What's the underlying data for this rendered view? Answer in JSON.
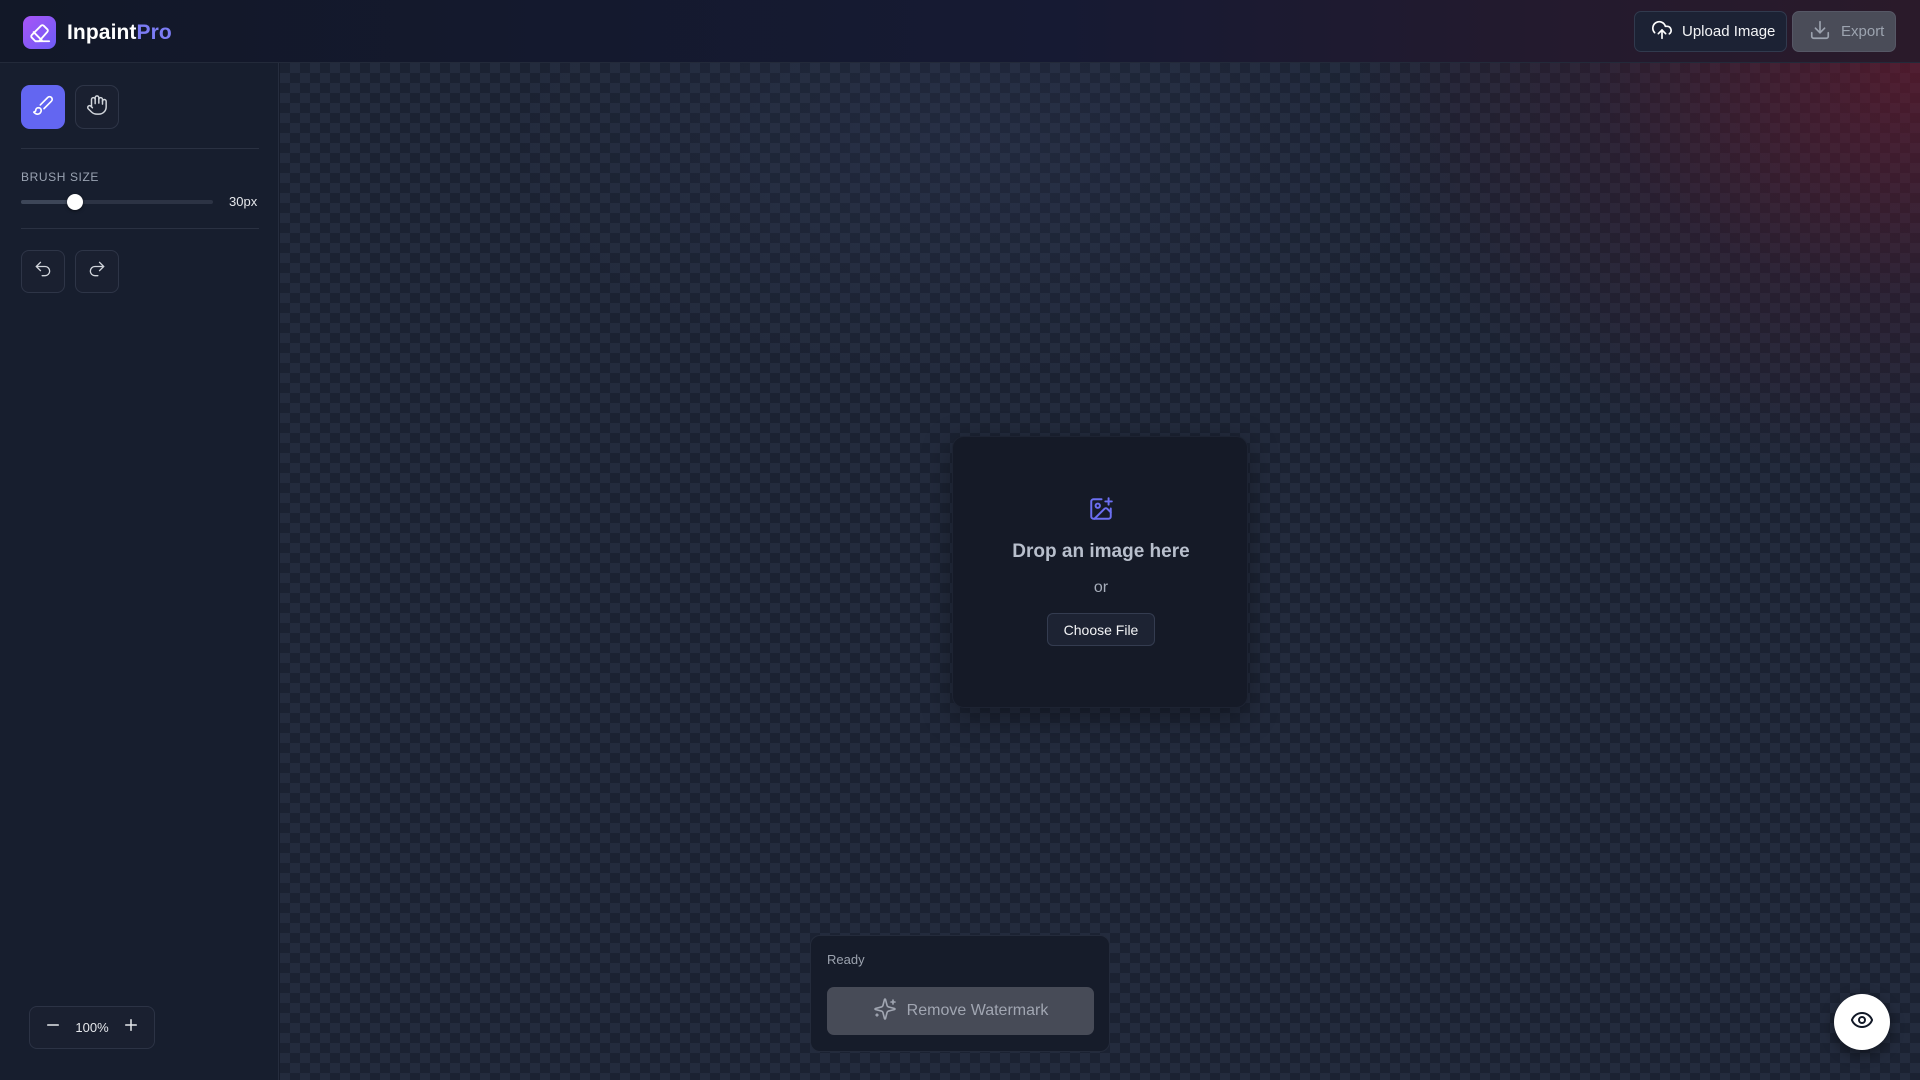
{
  "app": {
    "name_main": "Inpaint",
    "name_accent": "Pro",
    "logo_icon": "eraser-icon"
  },
  "header": {
    "upload_label": "Upload Image",
    "upload_icon": "cloud-upload-icon",
    "export_label": "Export",
    "export_icon": "download-icon",
    "export_enabled": false
  },
  "sidebar": {
    "tools": [
      {
        "name": "brush",
        "icon": "brush-icon",
        "active": true
      },
      {
        "name": "pan",
        "icon": "hand-icon",
        "active": false
      }
    ],
    "brush_size": {
      "label": "BRUSH SIZE",
      "value_text": "30px",
      "value": 30,
      "slider_fraction": 0.28
    },
    "history": {
      "undo_icon": "undo-icon",
      "redo_icon": "redo-icon"
    },
    "zoom": {
      "value_text": "100%",
      "minus_icon": "minus-icon",
      "plus_icon": "plus-icon"
    }
  },
  "canvas": {
    "dropzone": {
      "icon": "image-plus-icon",
      "title": "Drop an image here",
      "or_text": "or",
      "button_label": "Choose File"
    },
    "action_panel": {
      "status": "Ready",
      "button_label": "Remove Watermark",
      "button_icon": "sparkles-icon",
      "button_enabled": false
    },
    "preview_icon": "eye-icon"
  },
  "colors": {
    "accent": "#6366f1",
    "brand_accent_text": "#7c7cf5",
    "background": "#161c2b"
  }
}
